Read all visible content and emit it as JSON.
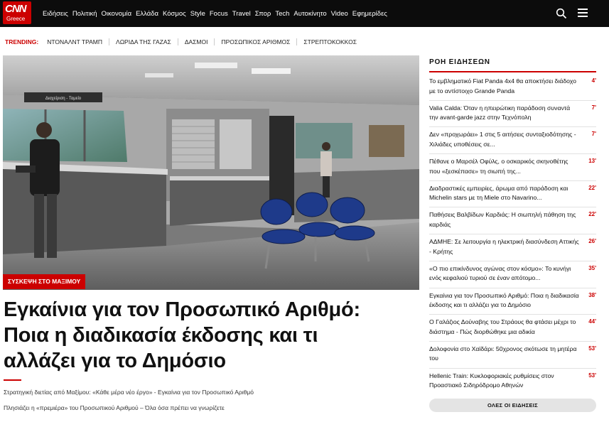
{
  "logo": {
    "main": "CNN",
    "sub": "Greece"
  },
  "nav": {
    "items": [
      "Ειδήσεις",
      "Πολιτική",
      "Οικονομία",
      "Ελλάδα",
      "Κόσμος",
      "Style",
      "Focus",
      "Travel",
      "Σπορ",
      "Tech",
      "Αυτοκίνητο",
      "Video",
      "Εφημερίδες"
    ]
  },
  "trending": {
    "label": "TRENDING:",
    "items": [
      "ΝΤΟΝΑΛΝΤ ΤΡΑΜΠ",
      "ΛΩΡΙΔΑ ΤΗΣ ΓΑΖΑΣ",
      "ΔΑΣΜΟΙ",
      "ΠΡΟΣΩΠΙΚΟΣ ΑΡΙΘΜΟΣ",
      "ΣΤΡΕΠΤΟΚΟΚΚΟΣ"
    ]
  },
  "hero": {
    "tag": "ΣΥΣΚΕΨΗ ΣΤΟ ΜΑΞΙΜΟΥ",
    "sign_text": "Διαχείριση - Ταμείο",
    "headline_lines": [
      "Εγκαίνια για τον Προσωπικό Αριθμό:",
      "Ποια η διαδικασία έκδοσης και τι",
      "αλλάζει για το Δημόσιο"
    ],
    "related": [
      "Στρατηγική διετίας από Μαξίμου: «Κάθε μέρα νέο έργο» - Εγκαίνια για τον Προσωπικό Αριθμό",
      "Πλησιάζει η «πρεμιέρα» του Προσωπικού Αριθμού – Όλα όσα πρέπει να γνωρίζετε"
    ]
  },
  "feed": {
    "title": "ΡΟΗ ΕΙΔΗΣΕΩΝ",
    "items": [
      {
        "text": "Το εμβληματικό Fiat Panda 4x4 θα αποκτήσει διάδοχο με το αντίστοιχο Grande Panda",
        "time": "4'"
      },
      {
        "text": "Valia Calda: Όταν η ηπειρώτικη παράδοση συναντά την avant-garde jazz στην Τεχνόπολη",
        "time": "7'"
      },
      {
        "text": "Δεν «προχωράει» 1 στις 5 αιτήσεις συνταξιοδότησης - Χιλιάδες υποθέσεις σε...",
        "time": "7'"
      },
      {
        "text": "Πέθανε ο Μαρσέλ Οφύλς, ο οσκαρικός σκηνοθέτης που «ξεσκέπασε» τη σιωπή της...",
        "time": "13'"
      },
      {
        "text": "Διαδραστικές εμπειρίες, άρωμα από παράδοση και Michelin stars με τη Miele στο Navarino...",
        "time": "22'"
      },
      {
        "text": "Παθήσεις Βαλβίδων Καρδιάς: Η σιωπηλή πάθηση της καρδιάς",
        "time": "22'"
      },
      {
        "text": "ΑΔΜΗΕ: Σε λειτουργία η ηλεκτρική διασύνδεση Αττικής - Κρήτης",
        "time": "26'"
      },
      {
        "text": "«Ο πιο επικίνδυνος αγώνας στον κόσμο»: Το κυνήγι ενός κεφαλιού τυριού σε έναν απότομο...",
        "time": "35'"
      },
      {
        "text": "Εγκαίνια για τον Προσωπικό Αριθμό: Ποια η διαδικασία έκδοσης και τι αλλάζει για το Δημόσιο",
        "time": "38'"
      },
      {
        "text": "Ο Γαλάζιος Δούναβης του Στράους θα φτάσει μέχρι το διάστημα - Πώς διορθώθηκε μια αδικία",
        "time": "44'"
      },
      {
        "text": "Δολοφονία στο Χαϊδάρι: 50χρονος σκότωσε τη μητέρα του",
        "time": "53'"
      },
      {
        "text": "Hellenic Train: Κυκλοφοριακές ρυθμίσεις στον Προαστιακό Σιδηρόδρομο Αθηνών",
        "time": "53'"
      }
    ],
    "all_news_label": "ΟΛΕΣ ΟΙ ΕΙΔΗΣΕΙΣ"
  },
  "colors": {
    "brand_red": "#cc0000",
    "nav_bg": "#0c0c0c",
    "chair_blue": "#1e3a8a"
  }
}
